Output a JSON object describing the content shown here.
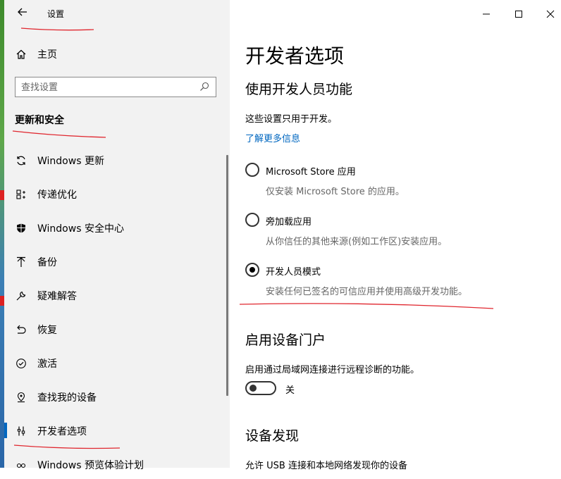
{
  "window": {
    "app_title": "设置",
    "controls": {
      "minimize": "minimize-icon",
      "maximize": "maximize-icon",
      "close": "close-icon"
    }
  },
  "sidebar": {
    "home_label": "主页",
    "search_placeholder": "查找设置",
    "section_title": "更新和安全",
    "items": [
      {
        "label": "Windows 更新",
        "icon": "sync-icon"
      },
      {
        "label": "传递优化",
        "icon": "delivery-optimization-icon"
      },
      {
        "label": "Windows 安全中心",
        "icon": "shield-icon"
      },
      {
        "label": "备份",
        "icon": "backup-arrow-icon"
      },
      {
        "label": "疑难解答",
        "icon": "wrench-icon"
      },
      {
        "label": "恢复",
        "icon": "recovery-icon"
      },
      {
        "label": "激活",
        "icon": "check-circle-icon"
      },
      {
        "label": "查找我的设备",
        "icon": "find-device-icon"
      },
      {
        "label": "开发者选项",
        "icon": "developer-tools-icon"
      },
      {
        "label": "Windows 预览体验计划",
        "icon": "insider-icon"
      }
    ],
    "selected_index": 8
  },
  "main": {
    "title": "开发者选项",
    "dev_features_heading": "使用开发人员功能",
    "dev_only_text": "这些设置只用于开发。",
    "learn_more_link": "了解更多信息",
    "options": [
      {
        "label": "Microsoft Store 应用",
        "desc": "仅安装 Microsoft Store 的应用。",
        "selected": false
      },
      {
        "label": "旁加载应用",
        "desc": "从你信任的其他来源(例如工作区)安装应用。",
        "selected": false
      },
      {
        "label": "开发人员模式",
        "desc": "安装任何已签名的可信应用并使用高级开发功能。",
        "selected": true
      }
    ],
    "device_portal_heading": "启用设备门户",
    "device_portal_desc": "启用通过局域网连接进行远程诊断的功能。",
    "device_portal_toggle": "关",
    "discovery_heading": "设备发现",
    "discovery_desc": "允许 USB 连接和本地网络发现你的设备"
  },
  "colors": {
    "accent": "#0067c0",
    "annotation": "#e0262e",
    "sidebar_bg": "#f2f2f2"
  }
}
